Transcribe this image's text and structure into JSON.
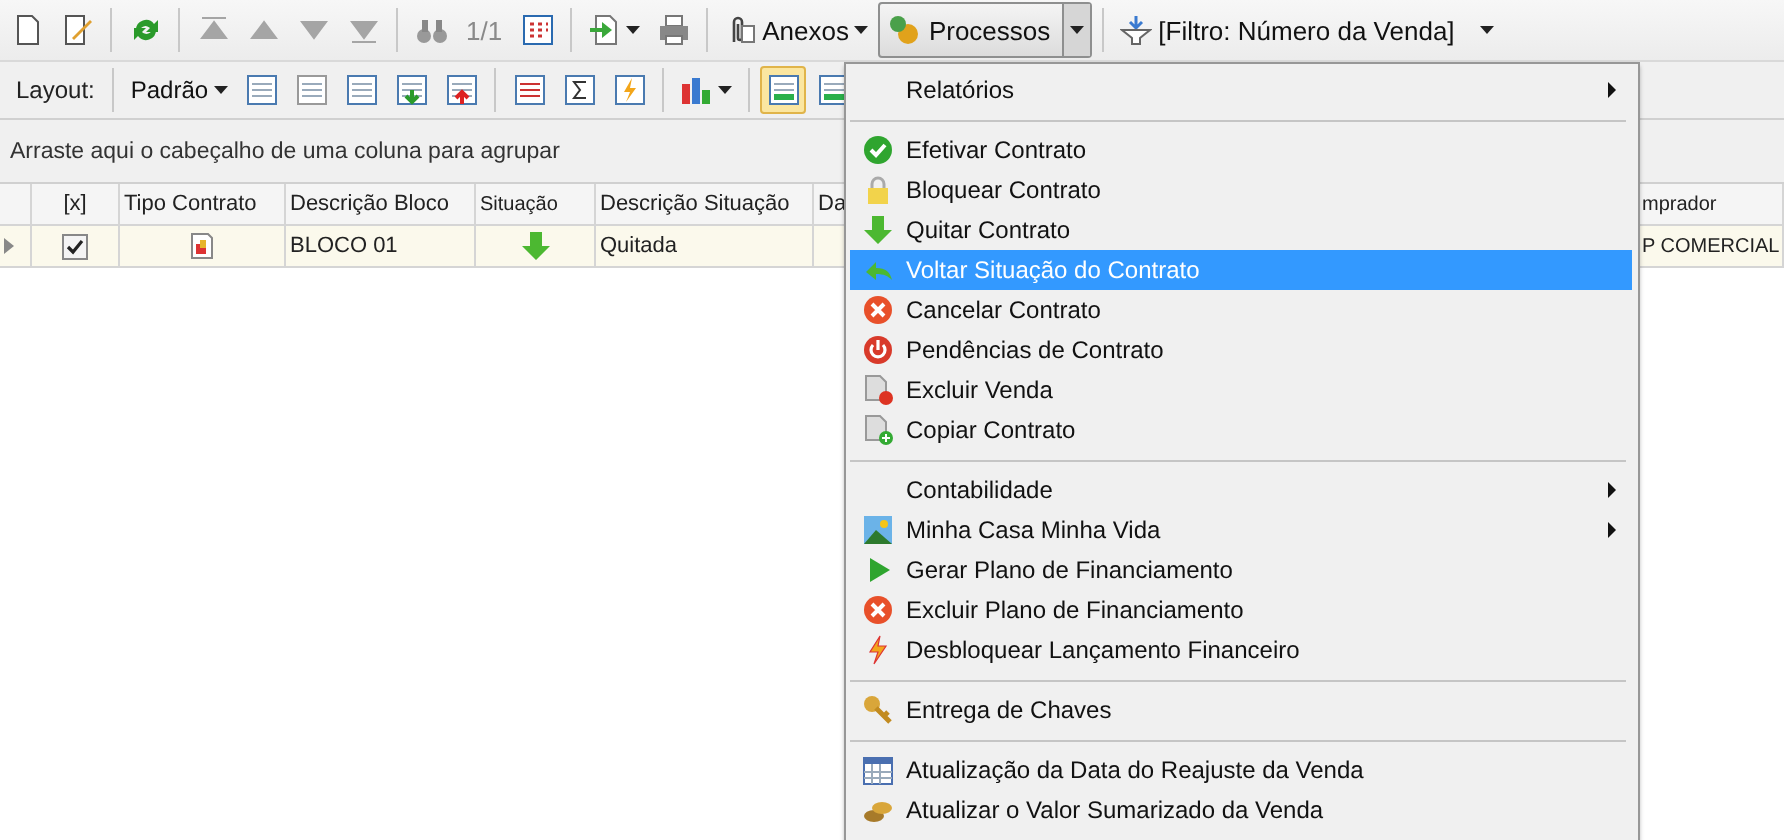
{
  "toolbar": {
    "nav_buttons": [
      {
        "disabled": true
      },
      {
        "disabled": true
      },
      {
        "disabled": true
      },
      {
        "disabled": true
      }
    ],
    "record_counter": "1/1",
    "attachments_button": "Anexos",
    "processes_button": {
      "label": "Processos",
      "pressed": true
    },
    "filter_button": "[Filtro: Número da Venda]"
  },
  "layout_bar": {
    "label": "Layout:",
    "layout_dropdown": "Padrão",
    "view_toggles": [
      {
        "selected": true
      },
      {
        "selected": false
      }
    ]
  },
  "group_panel": {
    "hint": "Arraste aqui o cabeçalho de uma coluna para agrupar"
  },
  "grid": {
    "columns": [
      "[x]",
      "Tipo Contrato",
      "Descrição Bloco",
      "Situação",
      "Descrição Situação",
      "Da",
      "mprador"
    ],
    "rows": [
      {
        "checked": true,
        "bloco": "BLOCO 01",
        "situacao": "Quitada",
        "comprador": "P COMERCIAL"
      }
    ]
  },
  "menu": {
    "entries": [
      {
        "kind": "item",
        "label": "Relatórios",
        "submenu": true,
        "selected": false
      },
      {
        "kind": "separator"
      },
      {
        "kind": "item",
        "label": "Efetivar Contrato",
        "submenu": false,
        "selected": false
      },
      {
        "kind": "item",
        "label": "Bloquear Contrato",
        "submenu": false,
        "selected": false
      },
      {
        "kind": "item",
        "label": "Quitar Contrato",
        "submenu": false,
        "selected": false
      },
      {
        "kind": "item",
        "label": "Voltar Situação do Contrato",
        "submenu": false,
        "selected": true
      },
      {
        "kind": "item",
        "label": "Cancelar Contrato",
        "submenu": false,
        "selected": false
      },
      {
        "kind": "item",
        "label": "Pendências de Contrato",
        "submenu": false,
        "selected": false
      },
      {
        "kind": "item",
        "label": "Excluir Venda",
        "submenu": false,
        "selected": false
      },
      {
        "kind": "item",
        "label": "Copiar Contrato",
        "submenu": false,
        "selected": false
      },
      {
        "kind": "separator"
      },
      {
        "kind": "item",
        "label": "Contabilidade",
        "submenu": true,
        "selected": false
      },
      {
        "kind": "item",
        "label": "Minha Casa Minha Vida",
        "submenu": true,
        "selected": false
      },
      {
        "kind": "item",
        "label": "Gerar Plano de Financiamento",
        "submenu": false,
        "selected": false
      },
      {
        "kind": "item",
        "label": "Excluir Plano de Financiamento",
        "submenu": false,
        "selected": false
      },
      {
        "kind": "item",
        "label": "Desbloquear Lançamento Financeiro",
        "submenu": false,
        "selected": false
      },
      {
        "kind": "separator"
      },
      {
        "kind": "item",
        "label": "Entrega de Chaves",
        "submenu": false,
        "selected": false
      },
      {
        "kind": "separator"
      },
      {
        "kind": "item",
        "label": "Atualização da Data do Reajuste da Venda",
        "submenu": false,
        "selected": false
      },
      {
        "kind": "item",
        "label": "Atualizar o Valor Sumarizado da Venda",
        "submenu": false,
        "selected": false
      }
    ]
  }
}
